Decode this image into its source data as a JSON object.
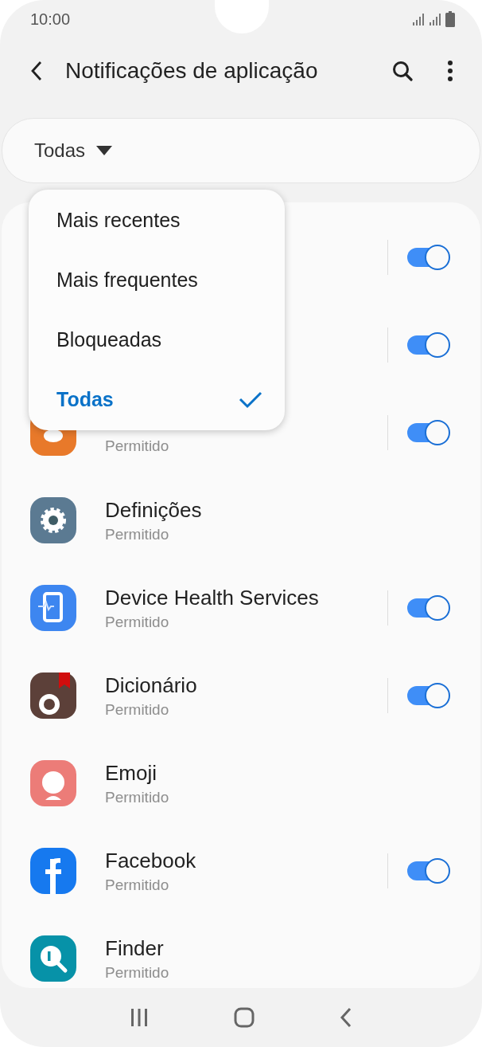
{
  "status_bar": {
    "time": "10:00"
  },
  "app_bar": {
    "title": "Notificações de aplicação"
  },
  "filter": {
    "value": "Todas"
  },
  "apps": [
    {
      "toggle": {
        "on": true
      }
    },
    {
      "toggle": {
        "on": true
      }
    },
    {
      "kind": "contacts",
      "status": "Permitido",
      "toggle": {
        "on": true
      }
    },
    {
      "kind": "settings",
      "name": "Definições",
      "status": "Permitido"
    },
    {
      "kind": "device-health",
      "name": "Device Health Services",
      "status": "Permitido",
      "toggle": {
        "on": true
      }
    },
    {
      "kind": "dictionary",
      "name": "Dicionário",
      "status": "Permitido",
      "toggle": {
        "on": true
      }
    },
    {
      "kind": "emoji",
      "name": "Emoji",
      "status": "Permitido"
    },
    {
      "kind": "facebook",
      "name": "Facebook",
      "status": "Permitido",
      "toggle": {
        "on": true
      }
    },
    {
      "kind": "finder",
      "name": "Finder",
      "status": "Permitido"
    }
  ],
  "filter_menu": [
    {
      "label": "Mais recentes",
      "selected": false
    },
    {
      "label": "Mais frequentes",
      "selected": false
    },
    {
      "label": "Bloqueadas",
      "selected": false
    },
    {
      "label": "Todas",
      "selected": true
    }
  ]
}
